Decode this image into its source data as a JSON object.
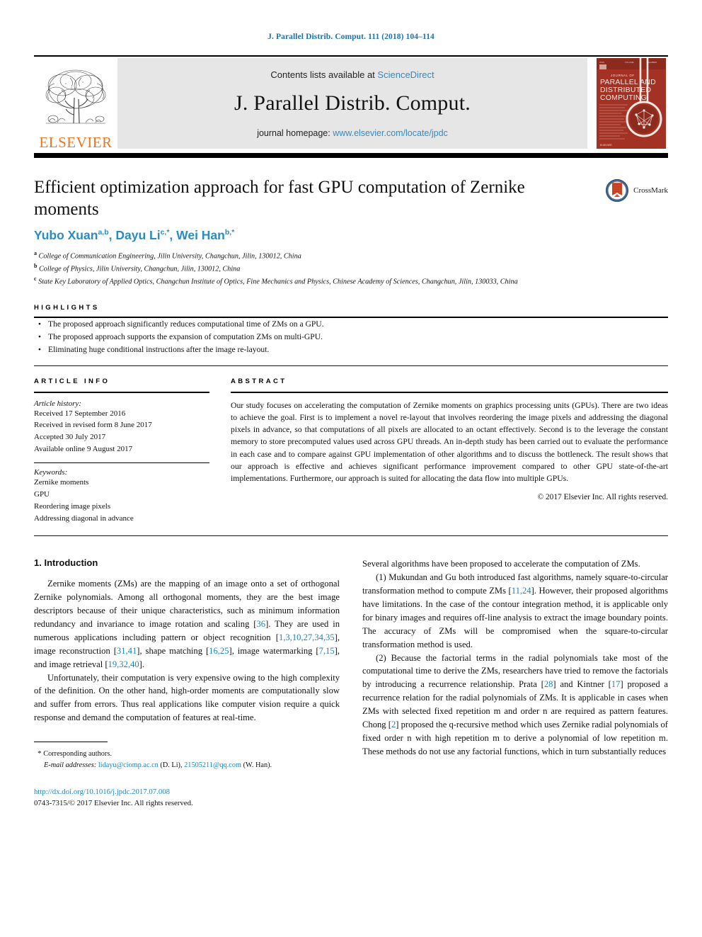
{
  "running_head": "J. Parallel Distrib. Comput. 111 (2018) 104–114",
  "masthead": {
    "publisher_name": "ELSEVIER",
    "contents_prefix": "Contents lists available at",
    "contents_link": "ScienceDirect",
    "journal_title": "J. Parallel Distrib. Comput.",
    "homepage_prefix": "journal homepage:",
    "homepage_link": "www.elsevier.com/locate/jpdc",
    "cover_title_lines": [
      "JOURNAL OF",
      "PARALLEL AND",
      "DISTRIBUTED",
      "COMPUTING"
    ]
  },
  "title_block": {
    "title": "Efficient optimization approach for fast GPU computation of Zernike moments",
    "authors_plain": "Yubo Xuan a,b, Dayu Li c,*, Wei Han b,*",
    "authors": [
      {
        "name": "Yubo Xuan",
        "sup": "a,b",
        "sep": ", "
      },
      {
        "name": "Dayu Li",
        "sup": "c,*",
        "sep": ", "
      },
      {
        "name": "Wei Han",
        "sup": "b,*",
        "sep": ""
      }
    ],
    "affiliations": [
      {
        "mark": "a",
        "text": "College of Communication Engineering, Jilin University, Changchun, Jilin, 130012, China"
      },
      {
        "mark": "b",
        "text": "College of Physics, Jilin University, Changchun, Jilin, 130012, China"
      },
      {
        "mark": "c",
        "text": "State Key Laboratory of Applied Optics, Changchun Institute of Optics, Fine Mechanics and Physics, Chinese Academy of Sciences, Changchun, Jilin, 130033, China"
      }
    ],
    "crossmark_label": "CrossMark"
  },
  "highlights": {
    "heading": "HIGHLIGHTS",
    "items": [
      "The proposed approach significantly reduces computational time of ZMs on a GPU.",
      "The proposed approach supports the expansion of computation ZMs on multi-GPU.",
      "Eliminating huge conditional instructions after the image re-layout."
    ]
  },
  "article_info": {
    "heading": "ARTICLE INFO",
    "history_label": "Article history:",
    "history": [
      "Received 17 September 2016",
      "Received in revised form 8 June 2017",
      "Accepted 30 July 2017",
      "Available online 9 August 2017"
    ],
    "keywords_label": "Keywords:",
    "keywords": [
      "Zernike moments",
      "GPU",
      "Reordering image pixels",
      "Addressing diagonal in advance"
    ]
  },
  "abstract": {
    "heading": "ABSTRACT",
    "text": "Our study focuses on accelerating the computation of Zernike moments on graphics processing units (GPUs). There are two ideas to achieve the goal. First is to implement a novel re-layout that involves reordering the image pixels and addressing the diagonal pixels in advance, so that computations of all pixels are allocated to an octant effectively. Second is to the leverage the constant memory to store precomputed values used across GPU threads. An in-depth study has been carried out to evaluate the performance in each case and to compare against GPU implementation of other algorithms and to discuss the bottleneck. The result shows that our approach is effective and achieves significant performance improvement compared to other GPU state-of-the-art implementations. Furthermore, our approach is suited for allocating the data flow into multiple GPUs.",
    "copyright": "© 2017 Elsevier Inc. All rights reserved."
  },
  "body": {
    "section_number_title": "1. Introduction",
    "left_paragraphs": [
      {
        "id": "p1",
        "runs": [
          {
            "t": "Zernike moments (ZMs) are the mapping of an image onto a set of orthogonal Zernike polynomials. Among all orthogonal moments, they are the best image descriptors because of their unique characteristics, such as minimum information redundancy and invariance to image rotation and scaling ["
          },
          {
            "t": "36",
            "ref": true
          },
          {
            "t": "]. They are used in numerous applications including pattern or object recognition ["
          },
          {
            "t": "1,3,10,27,34,35",
            "ref": true
          },
          {
            "t": "], image reconstruction ["
          },
          {
            "t": "31,41",
            "ref": true
          },
          {
            "t": "], shape matching ["
          },
          {
            "t": "16,25",
            "ref": true
          },
          {
            "t": "], image watermarking ["
          },
          {
            "t": "7,15",
            "ref": true
          },
          {
            "t": "], and image retrieval ["
          },
          {
            "t": "19,32,40",
            "ref": true
          },
          {
            "t": "]."
          }
        ]
      },
      {
        "id": "p2",
        "runs": [
          {
            "t": "Unfortunately, their computation is very expensive owing to the high complexity of the definition. On the other hand, high-order moments are computationally slow and suffer from errors. Thus real applications like computer vision require a quick response and demand the computation of features at real-time."
          }
        ]
      }
    ],
    "right_paragraphs": [
      {
        "id": "p3",
        "noindent": true,
        "runs": [
          {
            "t": "Several algorithms have been proposed to accelerate the computation of ZMs."
          }
        ]
      },
      {
        "id": "p4",
        "runs": [
          {
            "t": "(1) Mukundan and Gu both introduced fast algorithms, namely square-to-circular transformation method to compute ZMs ["
          },
          {
            "t": "11,24",
            "ref": true
          },
          {
            "t": "]. However, their proposed algorithms have limitations. In the case of the contour integration method, it is applicable only for binary images and requires off-line analysis to extract the image boundary points. The accuracy of ZMs will be compromised when the square-to-circular transformation method is used."
          }
        ]
      },
      {
        "id": "p5",
        "runs": [
          {
            "t": "(2) Because the factorial terms in the radial polynomials take most of the computational time to derive the ZMs, researchers have tried to remove the factorials by introducing a recurrence relationship. Prata ["
          },
          {
            "t": "28",
            "ref": true
          },
          {
            "t": "] and Kintner ["
          },
          {
            "t": "17",
            "ref": true
          },
          {
            "t": "] proposed a recurrence relation for the radial polynomials of ZMs. It is applicable in cases when ZMs with selected fixed repetition m and order n are required as pattern features. Chong ["
          },
          {
            "t": "2",
            "ref": true
          },
          {
            "t": "] proposed the q-recursive method which uses Zernike radial polynomials of fixed order n with high repetition m to derive a polynomial of low repetition m. These methods do not use any factorial functions, which in turn substantially reduces"
          }
        ]
      }
    ]
  },
  "footnote": {
    "star": "*",
    "corresponding": "Corresponding authors.",
    "email_label": "E-mail addresses:",
    "emails": [
      {
        "address": "lidayu@ciomp.ac.cn",
        "owner": "(D. Li)",
        "sep": ","
      },
      {
        "address": "21505211@qq.com",
        "owner": "(W. Han).",
        "sep": ""
      }
    ],
    "doi": "http://dx.doi.org/10.1016/j.jpdc.2017.07.008",
    "issn_line": "0743-7315/© 2017 Elsevier Inc. All rights reserved."
  },
  "colors": {
    "link_blue": "#2f8bc4",
    "ref_blue": "#1f84bd",
    "author_blue": "#2a8cbf",
    "elsevier_orange": "#E87722",
    "cover_red": "#A33124"
  }
}
